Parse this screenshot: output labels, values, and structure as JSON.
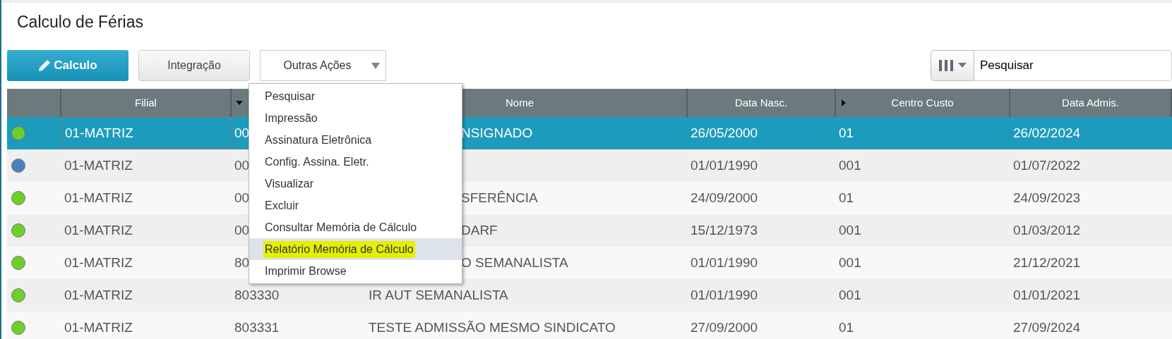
{
  "title": "Calculo de Férias",
  "toolbar": {
    "buttons": [
      {
        "label": "Calculo",
        "kind": "primary"
      },
      {
        "label": "Integração",
        "kind": "plain"
      },
      {
        "label": "Outras Ações",
        "kind": "dropdown"
      }
    ],
    "search": {
      "placeholder": "Pesquisar"
    }
  },
  "table": {
    "columns": [
      {
        "label": "Filial",
        "kind": "plain"
      },
      {
        "kind": "sort_down"
      },
      {
        "label": "Nome",
        "kind": "plain"
      },
      {
        "label": "Data Nasc.",
        "kind": "plain"
      },
      {
        "label": "Centro Custo",
        "kind": "sort_right"
      },
      {
        "label": "Data Admis.",
        "kind": "plain"
      }
    ],
    "rows": [
      {
        "selected": true,
        "under_menu": true,
        "color": "#6fcf2a",
        "cells": [
          "01-MATRIZ",
          "00",
          "NSIGNADO",
          "26/05/2000",
          "01",
          "26/02/2024"
        ]
      },
      {
        "selected": false,
        "color": "#4a7fc0",
        "cells": [
          "01-MATRIZ",
          "00",
          "",
          "01/01/1990",
          "001",
          "01/07/2022"
        ]
      },
      {
        "selected": false,
        "under_menu": true,
        "color": "#6fcf2a",
        "cells": [
          "01-MATRIZ",
          "00",
          "SFERÊNCIA",
          "24/09/2000",
          "01",
          "24/09/2023"
        ]
      },
      {
        "selected": false,
        "under_menu": true,
        "color": "#6fcf2a",
        "cells": [
          "01-MATRIZ",
          "00",
          "DARF",
          "15/12/1973",
          "001",
          "01/03/2012"
        ]
      },
      {
        "selected": false,
        "under_menu": true,
        "color": "#6fcf2a",
        "cells": [
          "01-MATRIZ",
          "80",
          "O SEMANALISTA",
          "01/01/1990",
          "001",
          "21/12/2021"
        ]
      },
      {
        "selected": false,
        "under_menu": false,
        "color": "#6fcf2a",
        "cells": [
          "01-MATRIZ",
          "803330",
          "IR AUT SEMANALISTA",
          "01/01/1990",
          "001",
          "01/01/2021"
        ]
      },
      {
        "selected": false,
        "under_menu": false,
        "color": "#6fcf2a",
        "cells": [
          "01-MATRIZ",
          "803331",
          "TESTE ADMISSÃO MESMO SINDICATO",
          "27/09/2000",
          "01",
          "27/09/2024"
        ]
      }
    ]
  },
  "menu": {
    "items": [
      {
        "label": "Pesquisar",
        "selected": false,
        "highlighted": false
      },
      {
        "label": "Impressão",
        "selected": false,
        "highlighted": false
      },
      {
        "label": "Assinatura Eletrônica",
        "selected": false,
        "highlighted": false
      },
      {
        "label": "Config. Assina. Eletr.",
        "selected": false,
        "highlighted": false
      },
      {
        "label": "Visualizar",
        "selected": false,
        "highlighted": false
      },
      {
        "label": "Excluir",
        "selected": false,
        "highlighted": false
      },
      {
        "label": "Consultar Memória de Cálculo",
        "selected": false,
        "highlighted": false
      },
      {
        "label": "Relatório Memória de Cálculo",
        "selected": true,
        "highlighted": true
      },
      {
        "label": "Imprimir Browse",
        "selected": false,
        "highlighted": false
      }
    ]
  }
}
